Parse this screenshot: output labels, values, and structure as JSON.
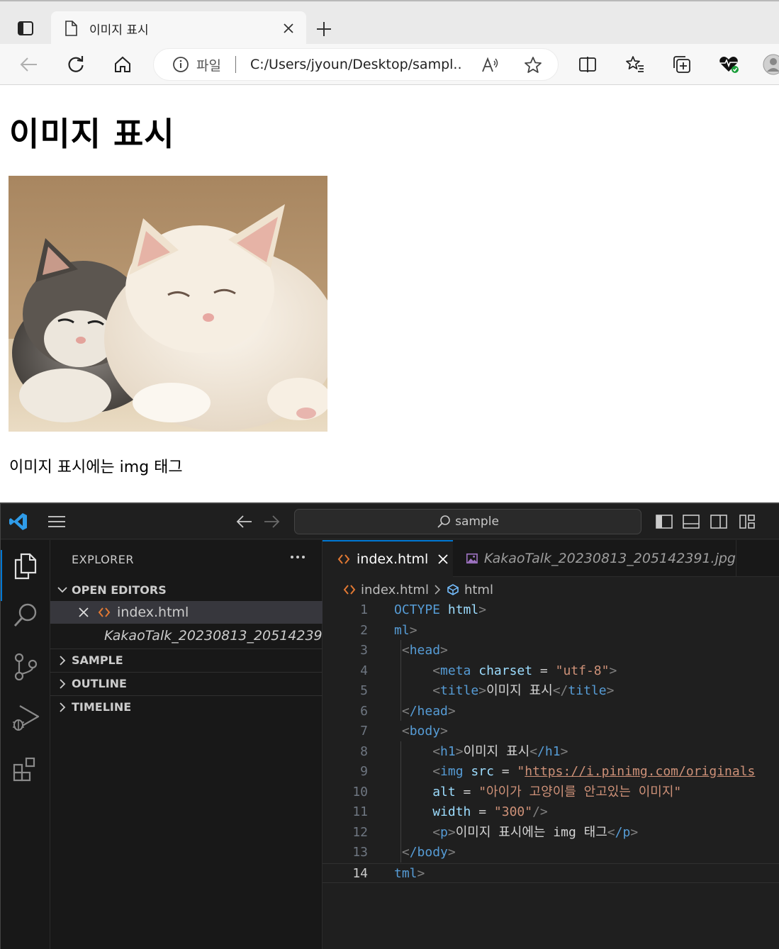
{
  "browser": {
    "tab_title": "이미지 표시",
    "address_scheme": "파일",
    "address_url": "C:/Users/jyoun/Desktop/sampl..."
  },
  "page": {
    "heading": "이미지 표시",
    "image_alt": "아이가 고양이를 안고있는 이미지",
    "paragraph": "이미지 표시에는 img 태그"
  },
  "vscode": {
    "search_text": "sample",
    "explorer_title": "EXPLORER",
    "sections": {
      "open_editors": "OPEN EDITORS",
      "sample": "SAMPLE",
      "outline": "OUTLINE",
      "timeline": "TIMELINE"
    },
    "open_editors": [
      {
        "name": "index.html"
      },
      {
        "name": "KakaoTalk_20230813_20514239..."
      }
    ],
    "tabs": [
      {
        "name": "index.html"
      },
      {
        "name": "KakaoTalk_20230813_205142391.jpg"
      }
    ],
    "breadcrumb": {
      "file": "index.html",
      "symbol": "html"
    },
    "line_numbers": [
      "1",
      "2",
      "3",
      "4",
      "5",
      "6",
      "7",
      "8",
      "9",
      "10",
      "11",
      "12",
      "13",
      "14"
    ],
    "code": {
      "l1_kw": "OCTYPE",
      "l1_name": "html",
      "l2_tag": "ml",
      "l3_tag": "head",
      "l4_tag": "meta",
      "l4_attr": "charset",
      "l4_val": "\"utf-8\"",
      "l5_tag": "title",
      "l5_text": "이미지 표시",
      "l6_tag": "/head",
      "l7_tag": "body",
      "l8_tag": "h1",
      "l8_text": "이미지 표시",
      "l8_close": "/h1",
      "l9_tag": "img",
      "l9_attr": "src",
      "l9_q": "\"",
      "l9_link": "https://i.pinimg.com/originals",
      "l10_attr": "alt",
      "l10_val": "\"아이가 고양이를 안고있는 이미지\"",
      "l11_attr": "width",
      "l11_val": "\"300\"",
      "l12_tag": "p",
      "l12_text": "이미지 표시에는 img 태그",
      "l12_close": "/p",
      "l13_tag": "/body",
      "l14_tag": "tml"
    }
  }
}
